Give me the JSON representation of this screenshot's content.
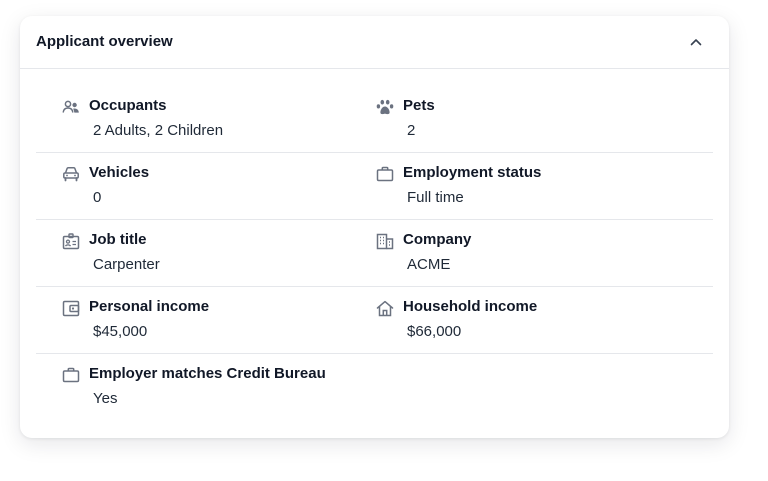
{
  "card": {
    "title": "Applicant overview",
    "collapse_icon": "chevron-up-icon"
  },
  "fields": [
    {
      "key": "occupants",
      "label": "Occupants",
      "value": "2 Adults, 2 Children",
      "icon": "users-icon"
    },
    {
      "key": "pets",
      "label": "Pets",
      "value": "2",
      "icon": "paw-icon"
    },
    {
      "key": "vehicles",
      "label": "Vehicles",
      "value": "0",
      "icon": "car-icon"
    },
    {
      "key": "employment_status",
      "label": "Employment status",
      "value": "Full time",
      "icon": "briefcase-icon"
    },
    {
      "key": "job_title",
      "label": "Job title",
      "value": "Carpenter",
      "icon": "id-badge-icon"
    },
    {
      "key": "company",
      "label": "Company",
      "value": "ACME",
      "icon": "building-icon"
    },
    {
      "key": "personal_income",
      "label": "Personal income",
      "value": "$45,000",
      "icon": "wallet-icon"
    },
    {
      "key": "household_income",
      "label": "Household income",
      "value": "$66,000",
      "icon": "house-icon"
    },
    {
      "key": "employer_matches",
      "label": "Employer matches Credit Bureau",
      "value": "Yes",
      "icon": "briefcase-icon"
    }
  ],
  "colors": {
    "icon": "#6b7280",
    "divider": "#e5e7eb",
    "text": "#111827"
  }
}
